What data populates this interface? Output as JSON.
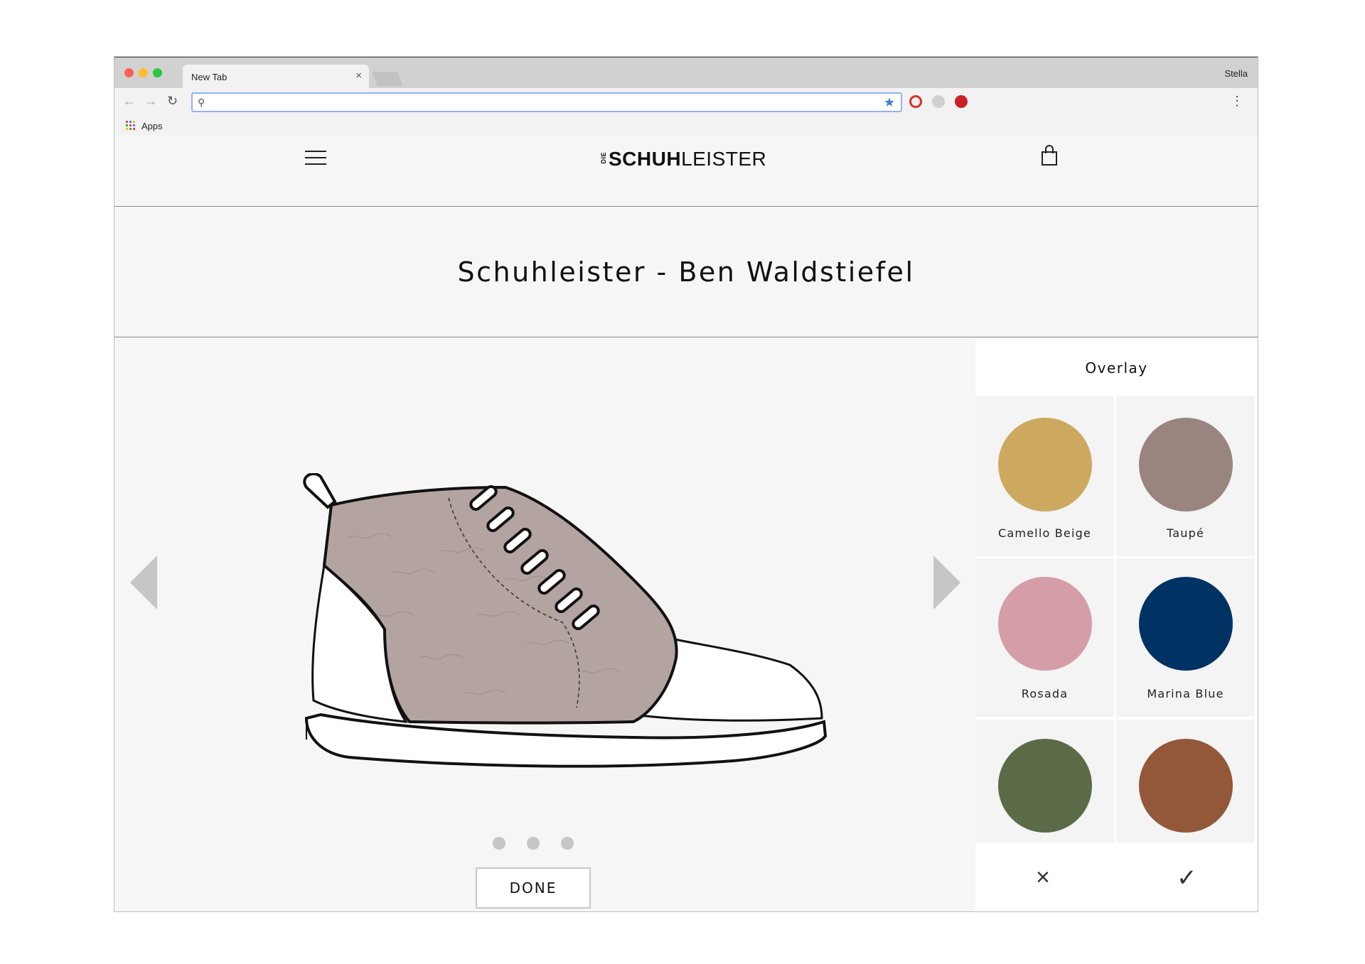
{
  "browser": {
    "tab_title": "New Tab",
    "tab_close": "×",
    "profile_name": "Stella",
    "bookmarks": {
      "apps_label": "Apps"
    },
    "omnibox_value": ""
  },
  "site": {
    "logo_small": "DIE",
    "logo_bold": "SCHUH",
    "logo_light": "LEISTER",
    "product_title": "Schuhleister - Ben Waldstiefel"
  },
  "carousel": {
    "slide_count": 3,
    "active_slide": 1,
    "done_label": "DONE"
  },
  "overlay_panel": {
    "title": "Overlay",
    "swatches": [
      {
        "name": "Camello Beige",
        "color": "#CCA95F"
      },
      {
        "name": "Taupé",
        "color": "#9A8480"
      },
      {
        "name": "Rosada",
        "color": "#D49DA8"
      },
      {
        "name": "Marina Blue",
        "color": "#003263"
      },
      {
        "name": "",
        "color": "#5B6A47"
      },
      {
        "name": "",
        "color": "#93573A"
      }
    ],
    "cancel_icon": "×",
    "confirm_icon": "✓"
  },
  "colors": {
    "shoe_upper": "#B3A4A1"
  }
}
